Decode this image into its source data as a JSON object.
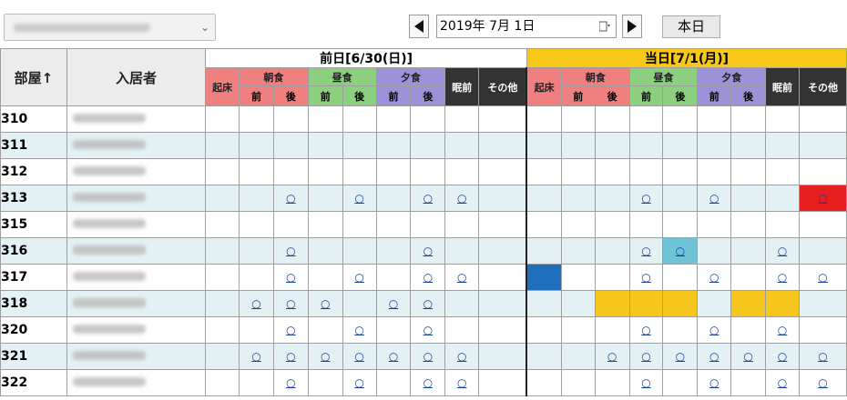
{
  "toolbar": {
    "facility_select_value": "",
    "date_value": "2019年  7月  1日",
    "today_label": "本日"
  },
  "headers": {
    "room": "部屋↑",
    "resident": "入居者",
    "prev_day": "前日[6/30(日)]",
    "cur_day": "当日[7/1(月)]",
    "wake": "起床",
    "breakfast": "朝食",
    "lunch": "昼食",
    "dinner": "夕食",
    "before_sleep": "眠前",
    "other": "その他",
    "before": "前",
    "after": "後"
  },
  "rows": [
    {
      "room": "310",
      "cells": [
        "",
        "",
        "",
        "",
        "",
        "",
        "",
        "",
        "",
        "",
        "",
        "",
        "",
        "",
        "",
        "",
        "",
        "",
        "",
        ""
      ]
    },
    {
      "room": "311",
      "cells": [
        "",
        "",
        "",
        "",
        "",
        "",
        "",
        "",
        "",
        "",
        "",
        "",
        "",
        "",
        "",
        "",
        "",
        "",
        "",
        ""
      ]
    },
    {
      "room": "312",
      "cells": [
        "",
        "",
        "",
        "",
        "",
        "",
        "",
        "",
        "",
        "",
        "",
        "",
        "",
        "",
        "",
        "",
        "",
        "",
        "",
        ""
      ]
    },
    {
      "room": "313",
      "cells": [
        "",
        "",
        "○",
        "",
        "○",
        "",
        "○",
        "○",
        "",
        "",
        "",
        "",
        "○",
        "",
        "○",
        "",
        "",
        "○",
        ""
      ]
    },
    {
      "room": "315",
      "cells": [
        "",
        "",
        "",
        "",
        "",
        "",
        "",
        "",
        "",
        "",
        "",
        "",
        "",
        "",
        "",
        "",
        "",
        "",
        "",
        ""
      ]
    },
    {
      "room": "316",
      "cells": [
        "",
        "",
        "○",
        "",
        "",
        "",
        "○",
        "",
        "",
        "",
        "",
        "",
        "○",
        "○",
        "",
        "",
        "○",
        "",
        ""
      ]
    },
    {
      "room": "317",
      "cells": [
        "",
        "",
        "○",
        "",
        "○",
        "",
        "○",
        "○",
        "",
        "",
        "",
        "",
        "○",
        "",
        "○",
        "",
        "○",
        "○",
        ""
      ]
    },
    {
      "room": "318",
      "cells": [
        "",
        "○",
        "○",
        "○",
        "",
        "○",
        "○",
        "",
        "",
        "",
        "",
        "",
        "",
        "",
        "",
        "",
        "",
        "",
        ""
      ]
    },
    {
      "room": "320",
      "cells": [
        "",
        "",
        "○",
        "",
        "○",
        "",
        "○",
        "",
        "",
        "",
        "",
        "",
        "○",
        "",
        "○",
        "",
        "○",
        "",
        ""
      ]
    },
    {
      "room": "321",
      "cells": [
        "",
        "○",
        "○",
        "○",
        "○",
        "○",
        "○",
        "○",
        "",
        "",
        "",
        "○",
        "○",
        "○",
        "○",
        "○",
        "○",
        "○",
        ""
      ]
    },
    {
      "room": "322",
      "cells": [
        "",
        "",
        "○",
        "",
        "○",
        "",
        "○",
        "○",
        "",
        "",
        "",
        "",
        "○",
        "",
        "○",
        "",
        "○",
        "○",
        ""
      ]
    }
  ],
  "colors": {
    "red": "#e81f1f",
    "blue": "#1f6fbd",
    "yellow": "#f6c61c",
    "cyan": "#6fc3d6"
  }
}
